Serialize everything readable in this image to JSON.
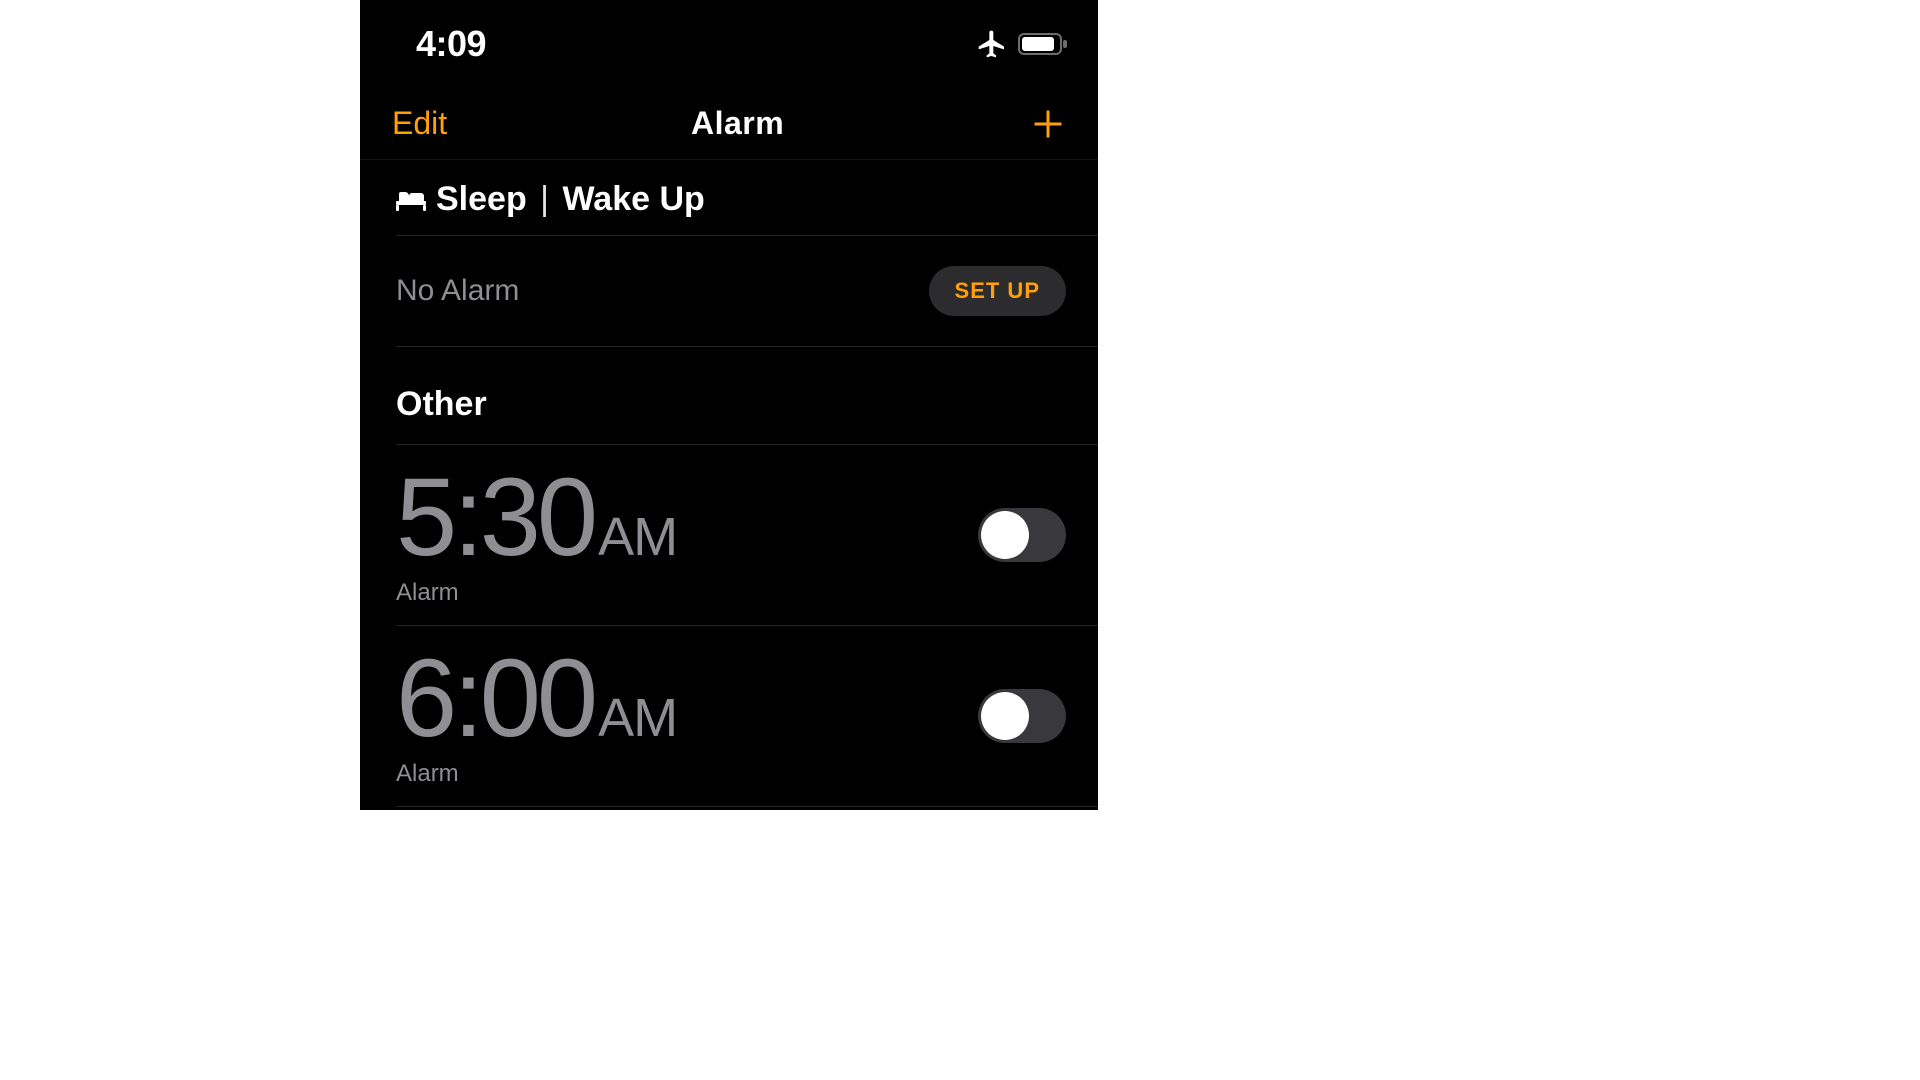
{
  "status": {
    "time": "4:09"
  },
  "nav": {
    "edit_label": "Edit",
    "title": "Alarm"
  },
  "sleep": {
    "title_sleep": "Sleep",
    "title_wakeup": "Wake Up",
    "no_alarm_label": "No Alarm",
    "setup_label": "SET UP"
  },
  "other": {
    "header_label": "Other",
    "alarms": [
      {
        "time": "5:30",
        "period": "AM",
        "label": "Alarm",
        "enabled": false
      },
      {
        "time": "6:00",
        "period": "AM",
        "label": "Alarm",
        "enabled": false
      }
    ]
  },
  "colors": {
    "accent": "#ff9f0a",
    "bg": "#000000",
    "muted": "#8e8e93",
    "toggle_off": "#39393d"
  }
}
